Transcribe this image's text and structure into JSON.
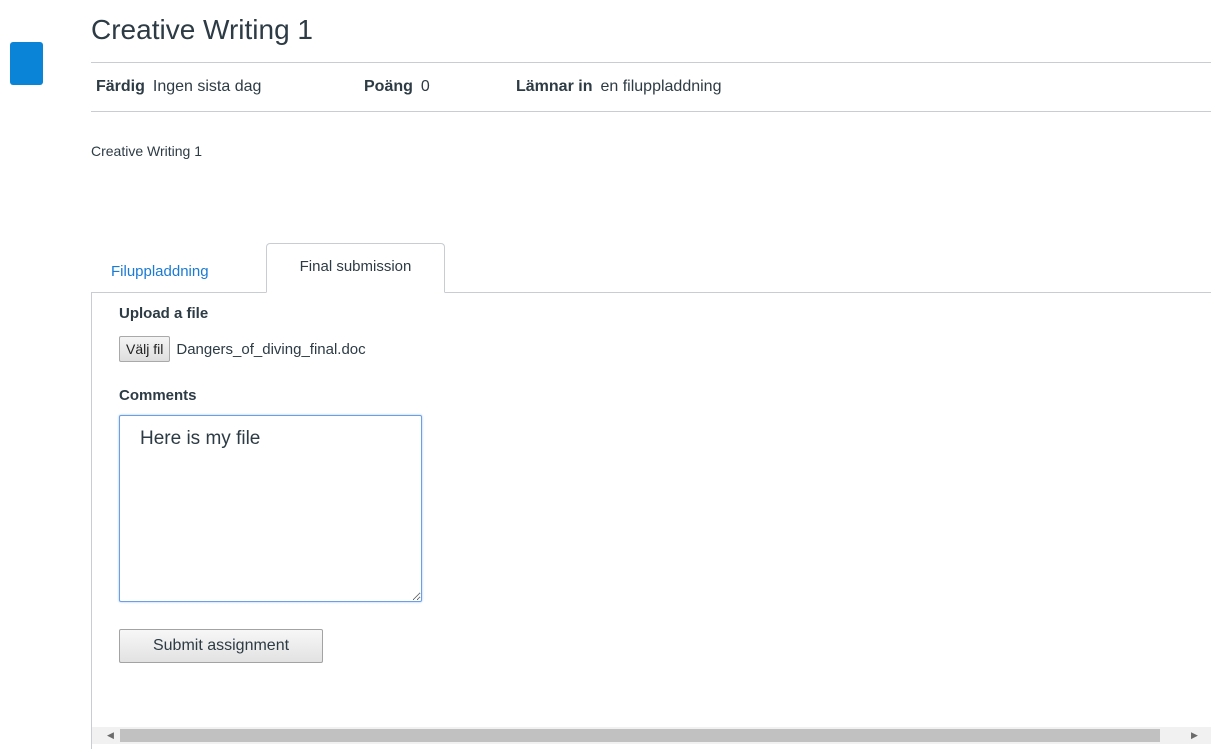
{
  "page": {
    "title": "Creative Writing 1",
    "description": "Creative Writing 1"
  },
  "details": {
    "done_label": "Färdig",
    "done_value": "Ingen sista dag",
    "points_label": "Poäng",
    "points_value": "0",
    "submitting_label": "Lämnar in",
    "submitting_value": "en filuppladdning"
  },
  "tabs": [
    {
      "label": "Filuppladdning",
      "active": false
    },
    {
      "label": "Final submission",
      "active": true
    }
  ],
  "form": {
    "upload_label": "Upload a file",
    "choose_file_label": "Välj fil",
    "file_name": "Dangers_of_diving_final.doc",
    "comments_label": "Comments",
    "comments_value": "Here is my file",
    "submit_label": "Submit assignment"
  },
  "colors": {
    "accent": "#0a84d6",
    "link": "#1a7ad4",
    "text": "#2d3b45"
  },
  "icons": {
    "scroll_left": "scroll-left-arrow-icon",
    "scroll_right": "scroll-right-arrow-icon"
  }
}
